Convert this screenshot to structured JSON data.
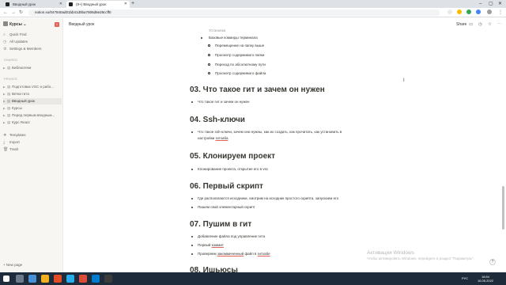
{
  "browser": {
    "tabs": [
      {
        "title": "Вводный урок",
        "active": false
      },
      {
        "title": "(9+) Вводный урок",
        "active": true
      }
    ],
    "url": "notion.so/047840ad01bb41d0ba7806d6e29ccff0"
  },
  "sidebar": {
    "workspace": "Курсы",
    "quick": [
      "Quick Find",
      "All Updates",
      "Settings & Members"
    ],
    "shared_label": "SHARED",
    "shared": [
      "Библиотеки"
    ],
    "private_label": "PRIVATE",
    "private": [
      "Подготовка VSC и рабо...",
      "Ветки гита",
      "Вводный урок",
      "Курсы",
      "Перед первым вводным...",
      "Курс React"
    ],
    "tools": [
      "Templates",
      "Import",
      "Trash"
    ],
    "new_page": "New page"
  },
  "topbar": {
    "breadcrumb": "Вводный урок",
    "share": "Share"
  },
  "content": {
    "top_partial": "Установка",
    "basics_item": "Базовые команды терминала",
    "basics_sub": [
      "Перемещение на папку выше",
      "Просмотр содержимого папки",
      "Переход по абсолютному пути",
      "Просмотр содержимого файла"
    ],
    "s3": {
      "title": "03. Что такое гит и зачем он нужен",
      "items": [
        "Что такое гит и зачем он нужен"
      ]
    },
    "s4": {
      "title": "04. Ssh-ключи",
      "item_a": "Что такое ssh-ключи, зачем они нужны, как их создать, как прочитать, как установить в",
      "item_b_pre": "настройки ",
      "item_b_link": "гитхаба"
    },
    "s5": {
      "title": "05. Клонируем проект",
      "items": [
        "Клонирование проекта, открытие его в vsc"
      ]
    },
    "s6": {
      "title": "06. Первый скрипт",
      "items": [
        "Где располагаются исходники, смотрим на исходник простого скрипта, запускаем его",
        "Пишем свой элементарный скрипт"
      ]
    },
    "s7": {
      "title": "07. Пушим в гит",
      "item1": "Добавление файла под управление гита",
      "item2_pre": "Первый ",
      "item2_link": "коммит",
      "item3_pre": "Проверяем ",
      "item3_link": "закоммиченный",
      "item3_mid": " файл в ",
      "item3_link2": "гитхабе"
    },
    "s8": {
      "title": "08. Ишьюсы"
    }
  },
  "watermark": {
    "line1": "Активация Windows",
    "line2": "Чтобы активировать Windows, перейдите в раздел \"Параметры\"."
  },
  "help": "?",
  "taskbar": {
    "lang": "РУС",
    "time": "18:54",
    "date": "16.05.2022"
  }
}
